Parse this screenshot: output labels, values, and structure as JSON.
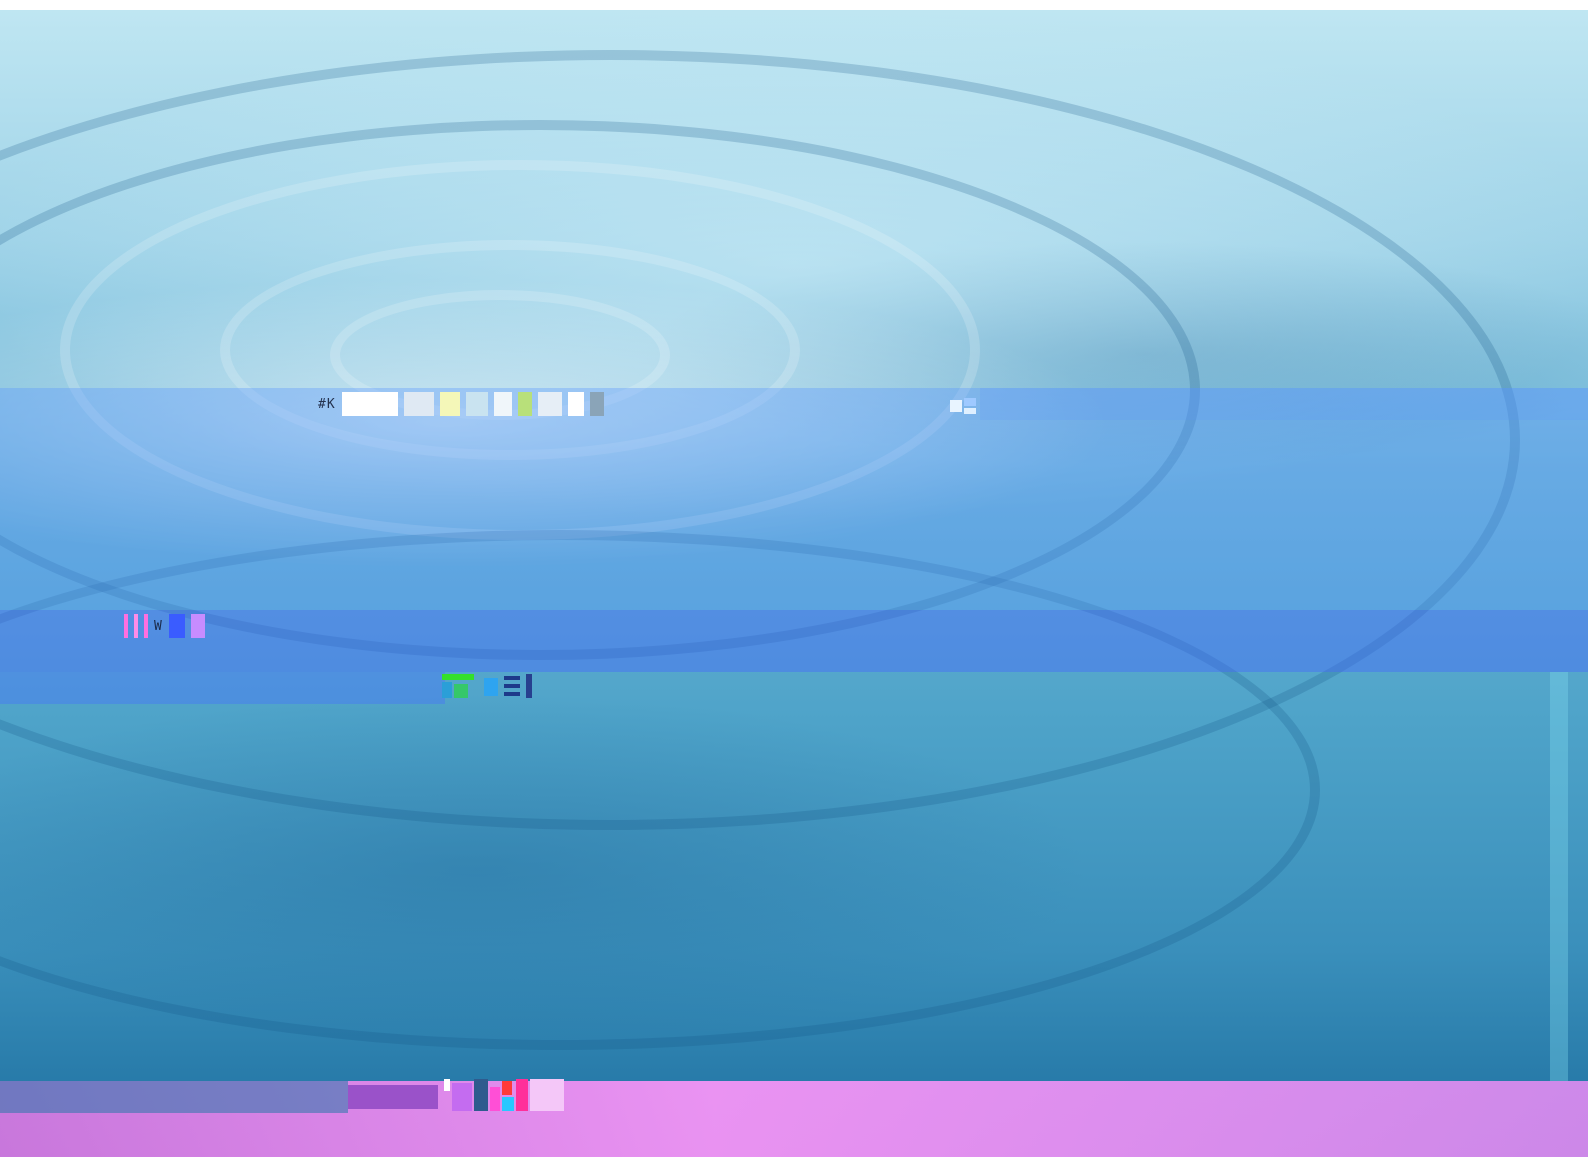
{
  "screen": {
    "background": "water-ripple-photo",
    "colors": {
      "water_light": "#bfe6f2",
      "water_mid": "#4ea3c9",
      "water_dark": "#1d6f9f",
      "band_blue": "#5a96ff",
      "band_indigo": "#4664ff",
      "band_pink": "#ff96fa"
    }
  },
  "title_bar": {
    "text": "#K"
  },
  "menu": {
    "icon": "window-glyph-icon"
  },
  "status_bar": {
    "text": "W"
  },
  "toolbar": {
    "icon": "toolbar-glyph-icon"
  },
  "taskbar": {
    "icon": "taskbar-glyph-icon"
  }
}
